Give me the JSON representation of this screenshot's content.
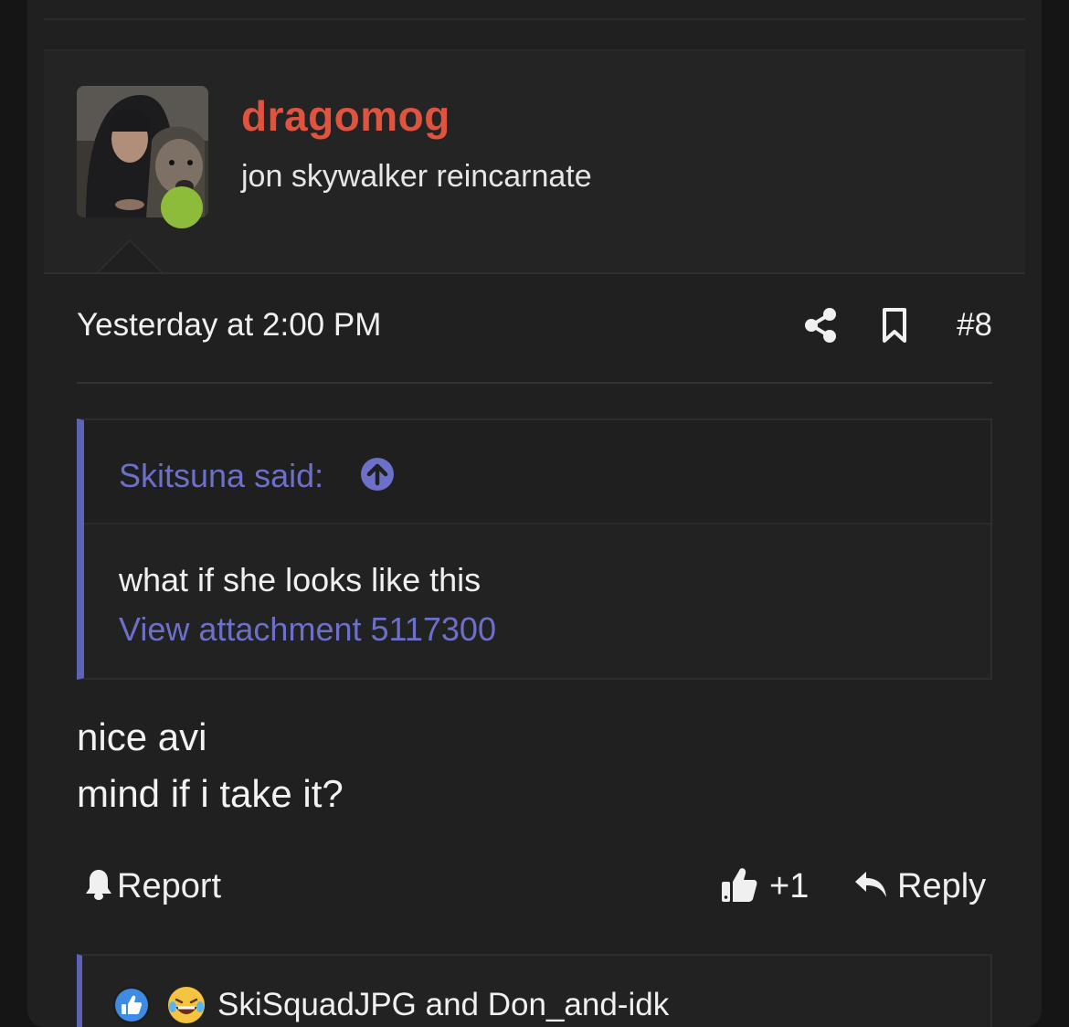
{
  "post": {
    "username": "dragomog",
    "user_title": "jon skywalker reincarnate",
    "timestamp": "Yesterday at 2:00 PM",
    "post_number": "#8",
    "quote": {
      "author": "Skitsuna said:",
      "text": "what if she looks like this",
      "attachment_link": "View attachment 5117300"
    },
    "body_lines": [
      "nice avi",
      "mind if i take it?"
    ],
    "actions": {
      "report_label": "Report",
      "like_label": "+1",
      "reply_label": "Reply"
    },
    "reactions": {
      "names": "SkiSquadJPG and Don_and-idk"
    }
  },
  "colors": {
    "username": "#e0533f",
    "accent": "#6c70c9",
    "online": "#8dbb3a",
    "background": "#202020"
  },
  "icons": [
    "share-icon",
    "bookmark-icon",
    "arrow-up-circle-icon",
    "bell-icon",
    "thumbs-up-icon",
    "reply-arrow-icon",
    "like-reaction-icon",
    "laugh-reaction-icon"
  ]
}
